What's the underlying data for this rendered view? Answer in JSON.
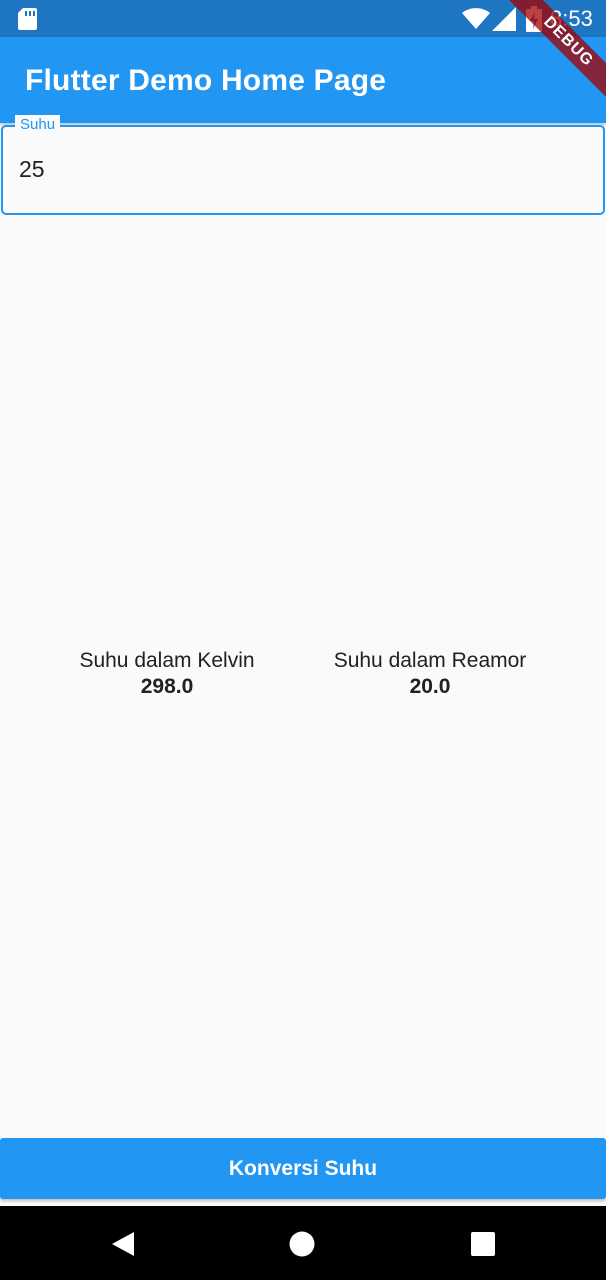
{
  "status_bar": {
    "time": "8:53",
    "icons": [
      "sd-card-icon",
      "wifi-icon",
      "cell-signal-icon",
      "battery-charging-icon"
    ]
  },
  "debug_banner": {
    "label": "DEBUG"
  },
  "app_bar": {
    "title": "Flutter Demo Home Page"
  },
  "form": {
    "field_label": "Suhu",
    "field_value": "25"
  },
  "results": {
    "kelvin": {
      "label": "Suhu dalam Kelvin",
      "value": "298.0"
    },
    "reamor": {
      "label": "Suhu dalam Reamor",
      "value": "20.0"
    }
  },
  "action": {
    "convert_label": "Konversi Suhu"
  },
  "nav_bar": {
    "icons": [
      "back-icon",
      "home-icon",
      "recents-icon"
    ]
  },
  "colors": {
    "primary": "#2196f3",
    "status_bar": "#1e76c2",
    "background": "#fafafa",
    "text": "#212121"
  }
}
